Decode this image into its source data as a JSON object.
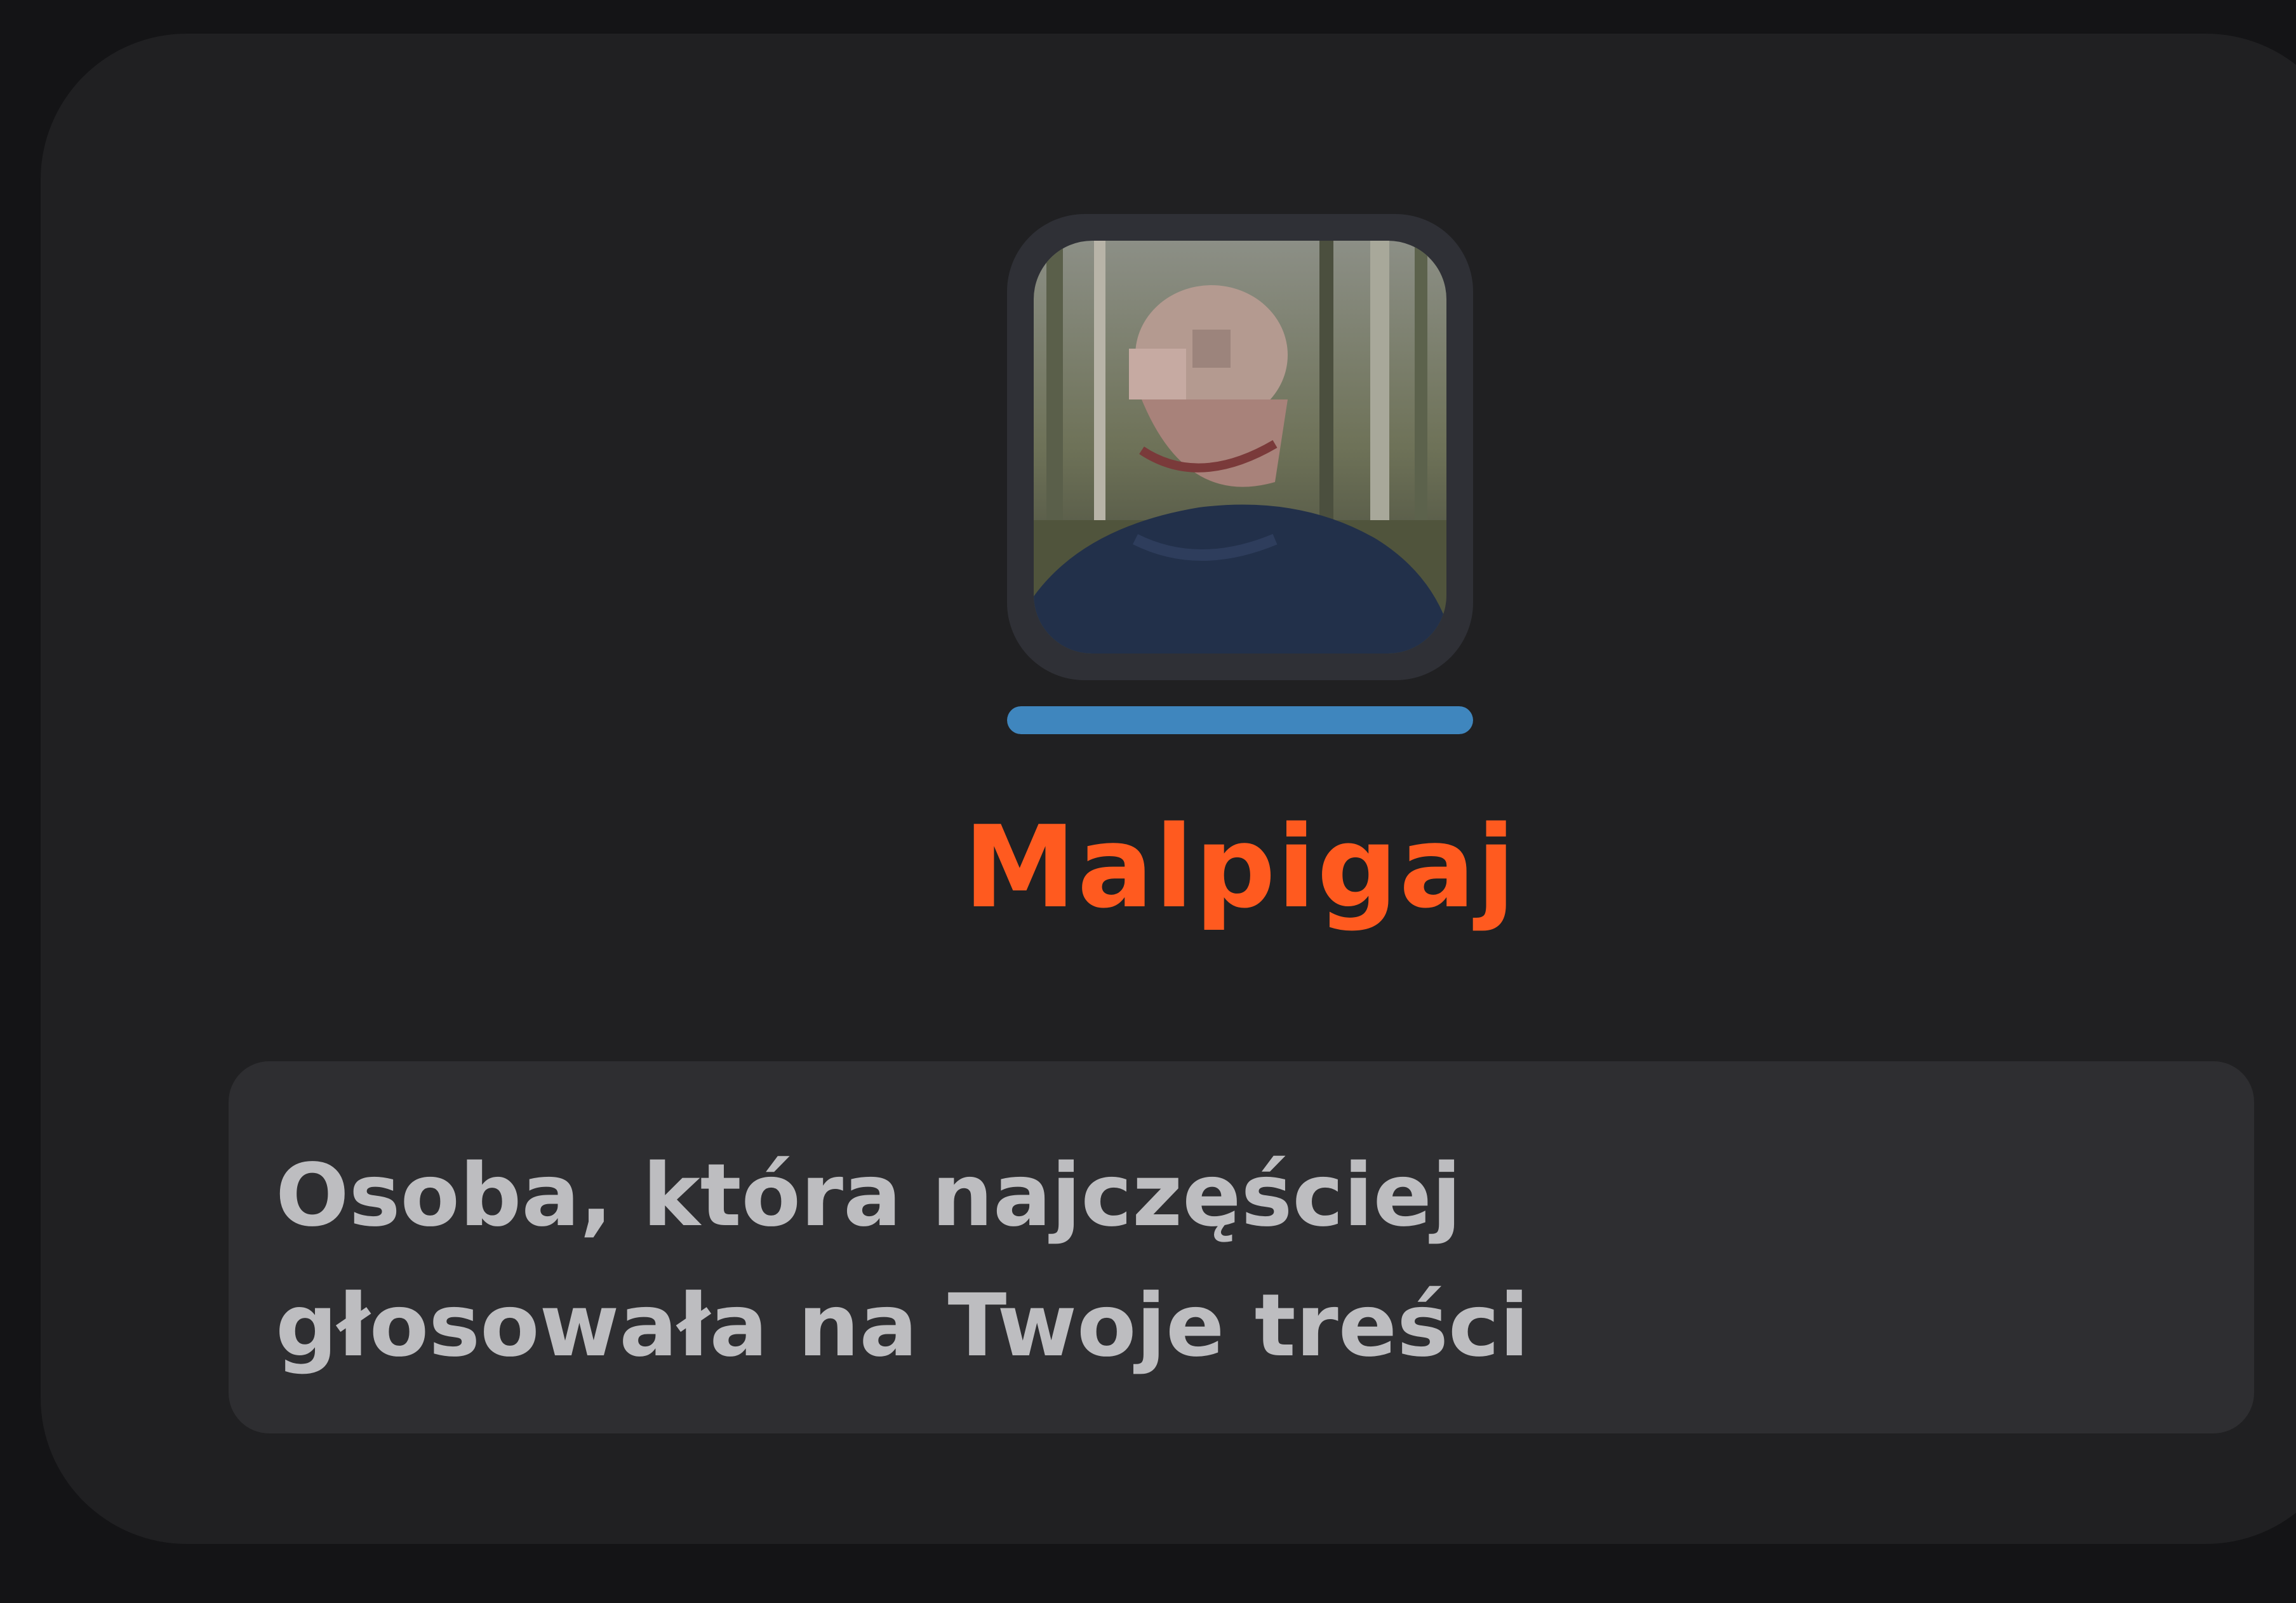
{
  "card": {
    "username": "Malpigaj",
    "username_color": "#ff5a1f",
    "avatar": {
      "icon": "user-avatar-photo"
    },
    "progress": {
      "value": 1.0,
      "color": "#3f86be"
    },
    "description_lines": [
      "Osoba, która najczęściej",
      "głosowała na Twoje treści"
    ]
  }
}
